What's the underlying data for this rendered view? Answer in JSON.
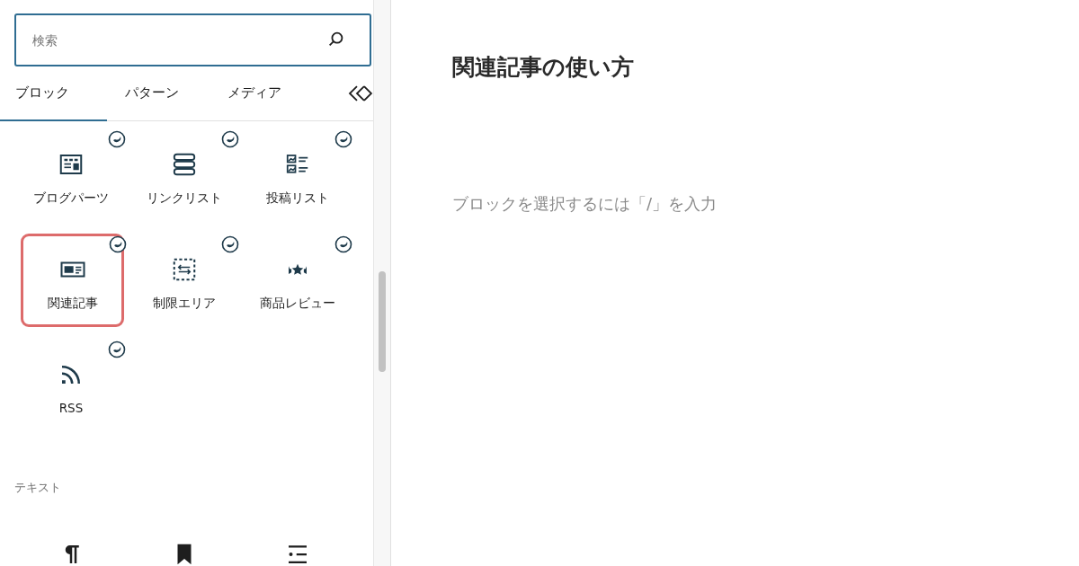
{
  "search": {
    "placeholder": "検索"
  },
  "tabs": [
    {
      "label": "ブロック",
      "selected": true
    },
    {
      "label": "パターン",
      "selected": false
    },
    {
      "label": "メディア",
      "selected": false
    }
  ],
  "blocks": [
    {
      "label": "ブログパーツ",
      "kind": "layout",
      "badge": true,
      "highlighted": false
    },
    {
      "label": "リンクリスト",
      "kind": "stack",
      "badge": true,
      "highlighted": false
    },
    {
      "label": "投稿リスト",
      "kind": "postlist",
      "badge": true,
      "highlighted": false
    },
    {
      "label": "関連記事",
      "kind": "card",
      "badge": true,
      "highlighted": true
    },
    {
      "label": "制限エリア",
      "kind": "dashed",
      "badge": true,
      "highlighted": false
    },
    {
      "label": "商品レビュー",
      "kind": "stars",
      "badge": true,
      "highlighted": false
    },
    {
      "label": "RSS",
      "kind": "rss",
      "badge": true,
      "highlighted": false
    }
  ],
  "text_section": {
    "title": "テキスト",
    "blocks": [
      {
        "kind": "pilcrow"
      },
      {
        "kind": "bookmark"
      },
      {
        "kind": "list"
      }
    ]
  },
  "editor": {
    "title": "関連記事の使い方",
    "placeholder": "ブロックを選択するには「/」を入力"
  }
}
